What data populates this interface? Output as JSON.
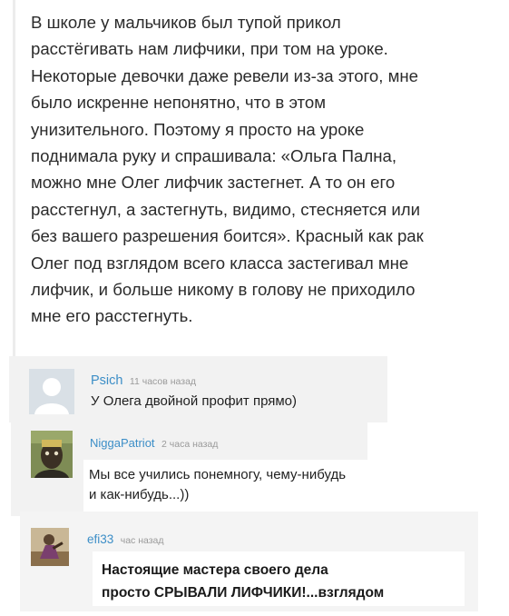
{
  "story": {
    "lines": [
      "В школе у мальчиков был тупой прикол",
      "расстёгивать нам лифчики, при том на уроке.",
      "Некоторые девочки даже ревели из-за этого, мне",
      "было искренне непонятно, что в этом",
      "унизительного. Поэтому я просто на уроке",
      "поднимала руку и спрашивала: «Ольга Пална,",
      "можно мне Олег лифчик застегнет. А то он его",
      "расстегнул, а застегнуть, видимо, стесняется или",
      "без вашего разрешения боится». Красный как рак",
      "Олег под взглядом всего класса застегивал мне",
      "лифчик, и больше никому в голову не приходило",
      "мне его расстегнуть."
    ]
  },
  "comments": [
    {
      "author": "Psich",
      "time": "11 часов назад",
      "avatar_icon": "default-user-avatar",
      "lines": [
        "У Олега двойной профит прямо)"
      ]
    },
    {
      "author": "NiggaPatriot",
      "time": "2 часа назад",
      "avatar_icon": "user-photo-avatar",
      "lines": [
        "Мы все учились понемногу, чему-нибудь",
        "и как-нибудь...))"
      ]
    },
    {
      "author": "efi33",
      "time": "час назад",
      "avatar_icon": "user-photo-avatar",
      "lines": [
        "Настоящие мастера своего дела",
        "просто СРЫВАЛИ ЛИФЧИКИ!...взглядом"
      ]
    }
  ],
  "colors": {
    "author": "#3c8ec7",
    "time": "#9a9a9a",
    "comment_bg": "#f2f2f2"
  }
}
